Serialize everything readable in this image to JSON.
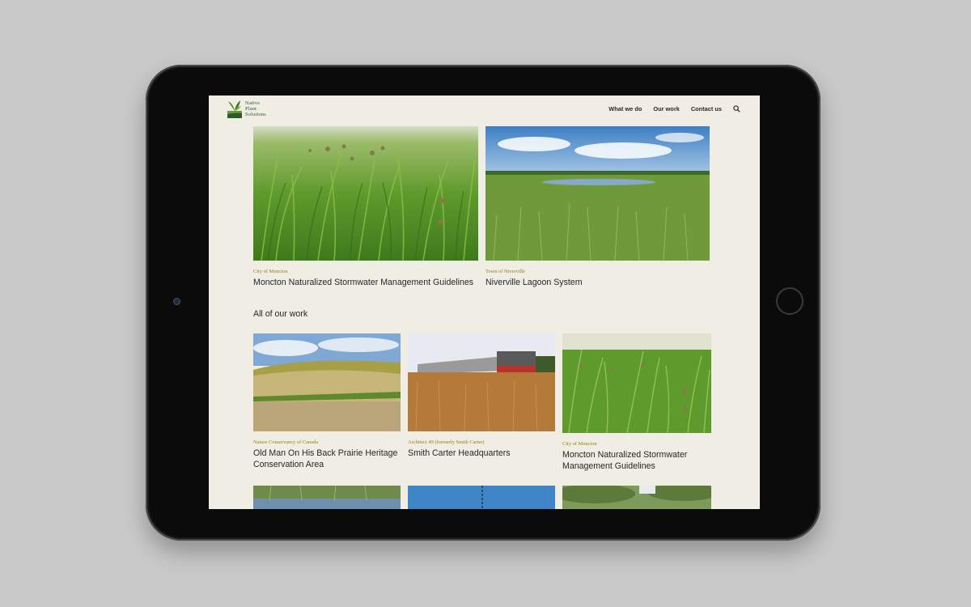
{
  "site": {
    "logo_text": "Native\nPlant\nSolutions"
  },
  "nav": {
    "items": [
      "What we do",
      "Our work",
      "Contact us"
    ]
  },
  "featured": [
    {
      "client": "City of Moncton",
      "title": "Moncton Naturalized Stormwater Management Guidelines"
    },
    {
      "client": "Town of Niverville",
      "title": "Niverville Lagoon System"
    }
  ],
  "all_work": {
    "heading": "All of our work",
    "items": [
      {
        "client": "Nature Conservancy of Canada",
        "title": "Old Man On His Back Prairie Heritage Conservation Area"
      },
      {
        "client": "Architect 49 (formerly Smith Carter)",
        "title": "Smith Carter Headquarters"
      },
      {
        "client": "City of Moncton",
        "title": "Moncton Naturalized Stormwater Management Guidelines"
      }
    ]
  },
  "colors": {
    "page_bg": "#c9c9c9",
    "screen_bg": "#efede4",
    "client_label": "#9a7d12",
    "logo_green": "#2e5a2c"
  },
  "icons": [
    "search-icon",
    "logo-leaf-icon"
  ]
}
